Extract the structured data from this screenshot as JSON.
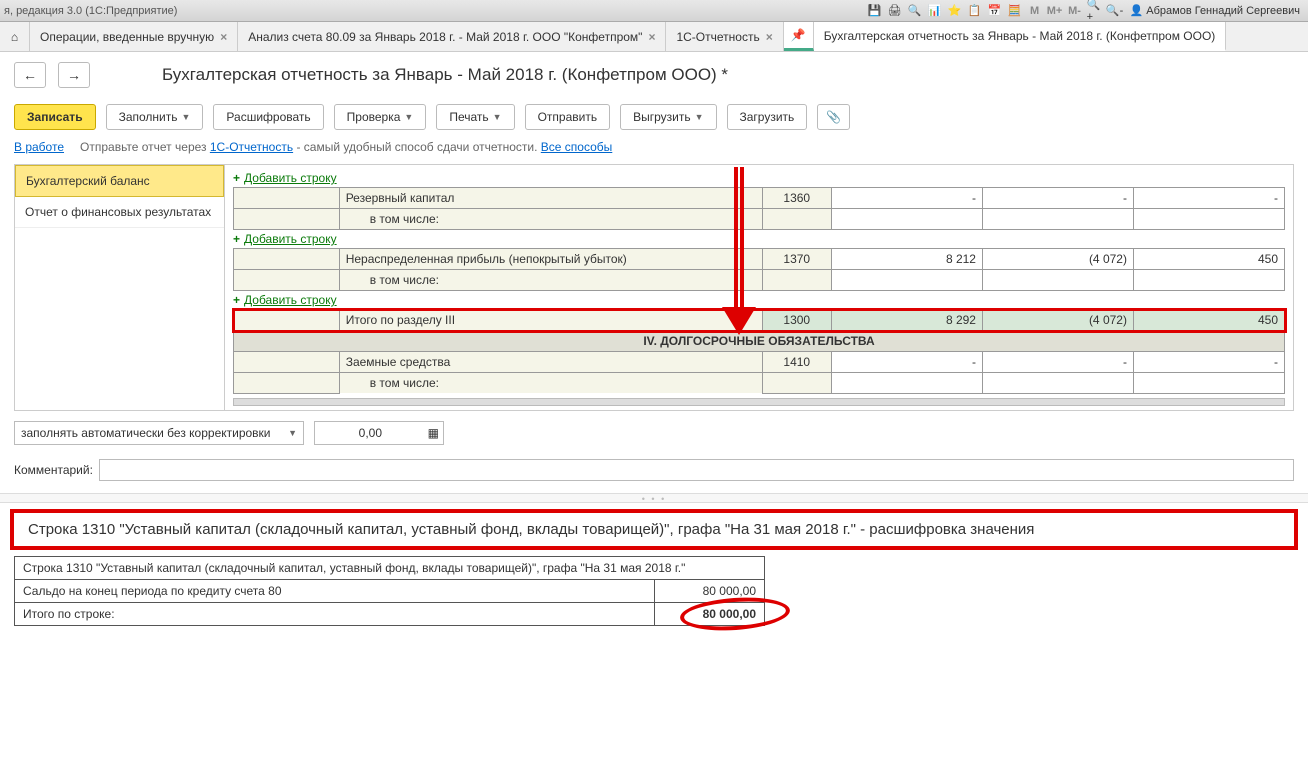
{
  "titlebar": {
    "left": "я, редакция 3.0  (1С:Предприятие)",
    "user": "Абрамов Геннадий Сергеевич",
    "icons": [
      "💾",
      "🖨",
      "🔍",
      "📊",
      "⭐",
      "📋",
      "📅",
      "🧮"
    ],
    "scale": {
      "m": "M",
      "mp": "M+",
      "mm": "M-"
    },
    "zoom": [
      "🔍+",
      "🔍-"
    ]
  },
  "tabs": {
    "t1": "Операции, введенные вручную",
    "t2": "Анализ счета 80.09 за Январь 2018 г. - Май 2018 г. ООО \"Конфетпром\"",
    "t3": "1С-Отчетность",
    "t4": "Бухгалтерская отчетность за Январь - Май 2018 г. (Конфетпром ООО)"
  },
  "pageTitle": "Бухгалтерская отчетность за Январь - Май 2018 г. (Конфетпром ООО) *",
  "toolbar": {
    "save": "Записать",
    "fill": "Заполнить",
    "decode": "Расшифровать",
    "check": "Проверка",
    "print": "Печать",
    "send": "Отправить",
    "upload": "Выгрузить",
    "load": "Загрузить"
  },
  "info": {
    "status": "В работе",
    "text1": "Отправьте отчет через ",
    "link1": "1С-Отчетность",
    "text2": " - самый удобный способ сдачи отчетности. ",
    "link2": "Все способы"
  },
  "left": {
    "i1": "Бухгалтерский баланс",
    "i2": "Отчет о финансовых результатах"
  },
  "addRow": "Добавить строку",
  "grid": {
    "r1": {
      "name": "Резервный капитал",
      "code": "1360",
      "v1": "-",
      "v2": "-",
      "v3": "-"
    },
    "r1b": {
      "name": "в том числе:"
    },
    "r2": {
      "name": "Нераспределенная прибыль (непокрытый убыток)",
      "code": "1370",
      "v1": "8 212",
      "v2": "(4 072)",
      "v3": "450"
    },
    "r2b": {
      "name": "в том числе:"
    },
    "total": {
      "name": "Итого по разделу III",
      "code": "1300",
      "v1": "8 292",
      "v2": "(4 072)",
      "v3": "450"
    },
    "section": "IV. ДОЛГОСРОЧНЫЕ ОБЯЗАТЕЛЬСТВА",
    "r3": {
      "name": "Заемные средства",
      "code": "1410",
      "v1": "-",
      "v2": "-",
      "v3": "-"
    },
    "r3b": {
      "name": "в том числе:"
    }
  },
  "bottom": {
    "select": "заполнять автоматически без корректировки",
    "num": "0,00",
    "commentLabel": "Комментарий:"
  },
  "detail": {
    "title": "Строка 1310 \"Уставный капитал (складочный капитал, уставный фонд, вклады товарищей)\", графа \"На 31 мая 2018 г.\" - расшифровка значения",
    "r1": {
      "desc": "Строка 1310 \"Уставный капитал (складочный капитал, уставный фонд, вклады товарищей)\", графа \"На 31 мая 2018 г.\""
    },
    "r2": {
      "desc": "Сальдо на конец периода по кредиту счета 80",
      "val": "80 000,00"
    },
    "r3": {
      "desc": "Итого по строке:",
      "val": "80 000,00"
    }
  }
}
